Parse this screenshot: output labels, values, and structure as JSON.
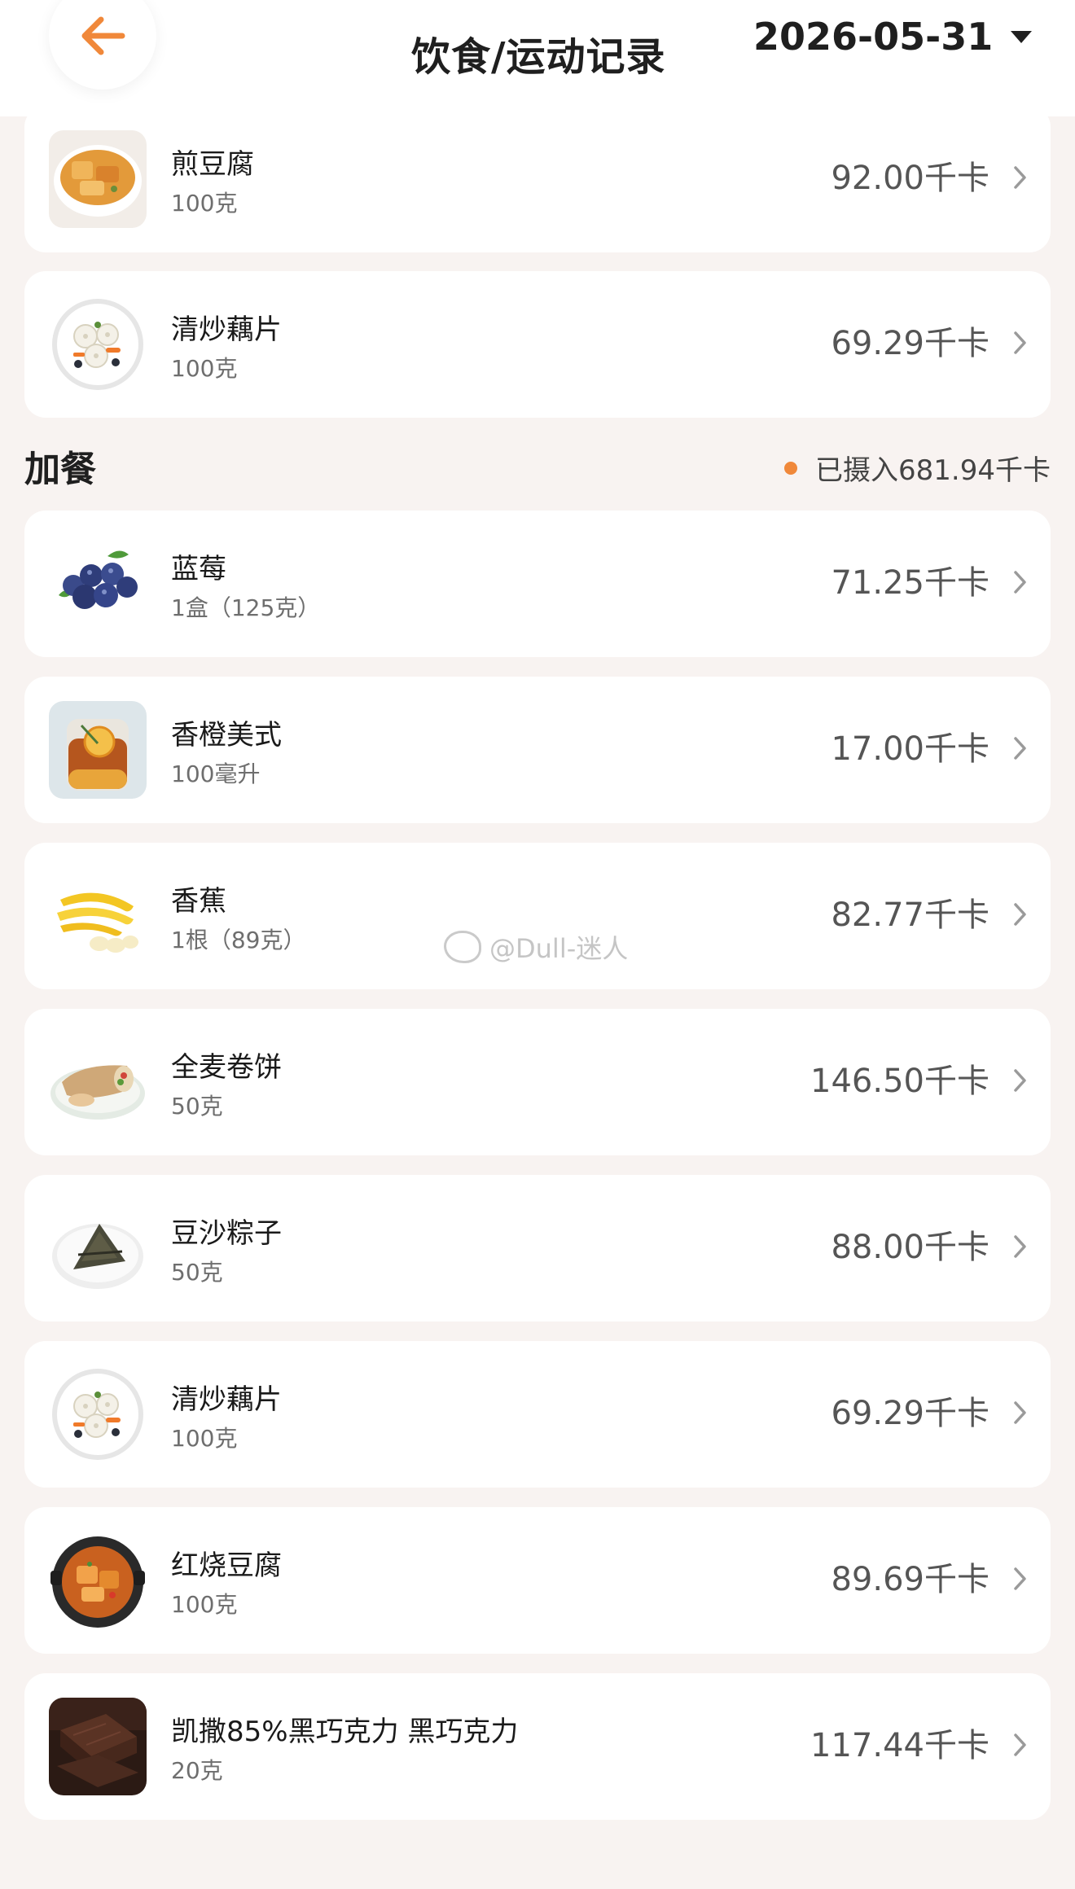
{
  "header": {
    "title": "饮食/运动记录",
    "date": "2026-05-31"
  },
  "colors": {
    "accent": "#f0883a",
    "background": "#f8f3f1",
    "card": "#ffffff"
  },
  "items_top": [
    {
      "name": "煎豆腐",
      "amount": "100克",
      "kcal": "92.00千卡",
      "icon": "fried-tofu"
    },
    {
      "name": "清炒藕片",
      "amount": "100克",
      "kcal": "69.29千卡",
      "icon": "lotus-root"
    }
  ],
  "snack_section": {
    "title": "加餐",
    "intake": "已摄入681.94千卡"
  },
  "snack_items": [
    {
      "name": "蓝莓",
      "amount": "1盒（125克）",
      "kcal": "71.25千卡",
      "icon": "blueberry"
    },
    {
      "name": "香橙美式",
      "amount": "100毫升",
      "kcal": "17.00千卡",
      "icon": "orange-americano"
    },
    {
      "name": "香蕉",
      "amount": "1根（89克）",
      "kcal": "82.77千卡",
      "icon": "banana"
    },
    {
      "name": "全麦卷饼",
      "amount": "50克",
      "kcal": "146.50千卡",
      "icon": "wrap"
    },
    {
      "name": "豆沙粽子",
      "amount": "50克",
      "kcal": "88.00千卡",
      "icon": "zongzi"
    },
    {
      "name": "清炒藕片",
      "amount": "100克",
      "kcal": "69.29千卡",
      "icon": "lotus-root"
    },
    {
      "name": "红烧豆腐",
      "amount": "100克",
      "kcal": "89.69千卡",
      "icon": "braised-tofu"
    },
    {
      "name": "凯撒85%黑巧克力 黑巧克力",
      "amount": "20克",
      "kcal": "117.44千卡",
      "icon": "dark-chocolate"
    }
  ],
  "watermark": "@Dull-迷人"
}
